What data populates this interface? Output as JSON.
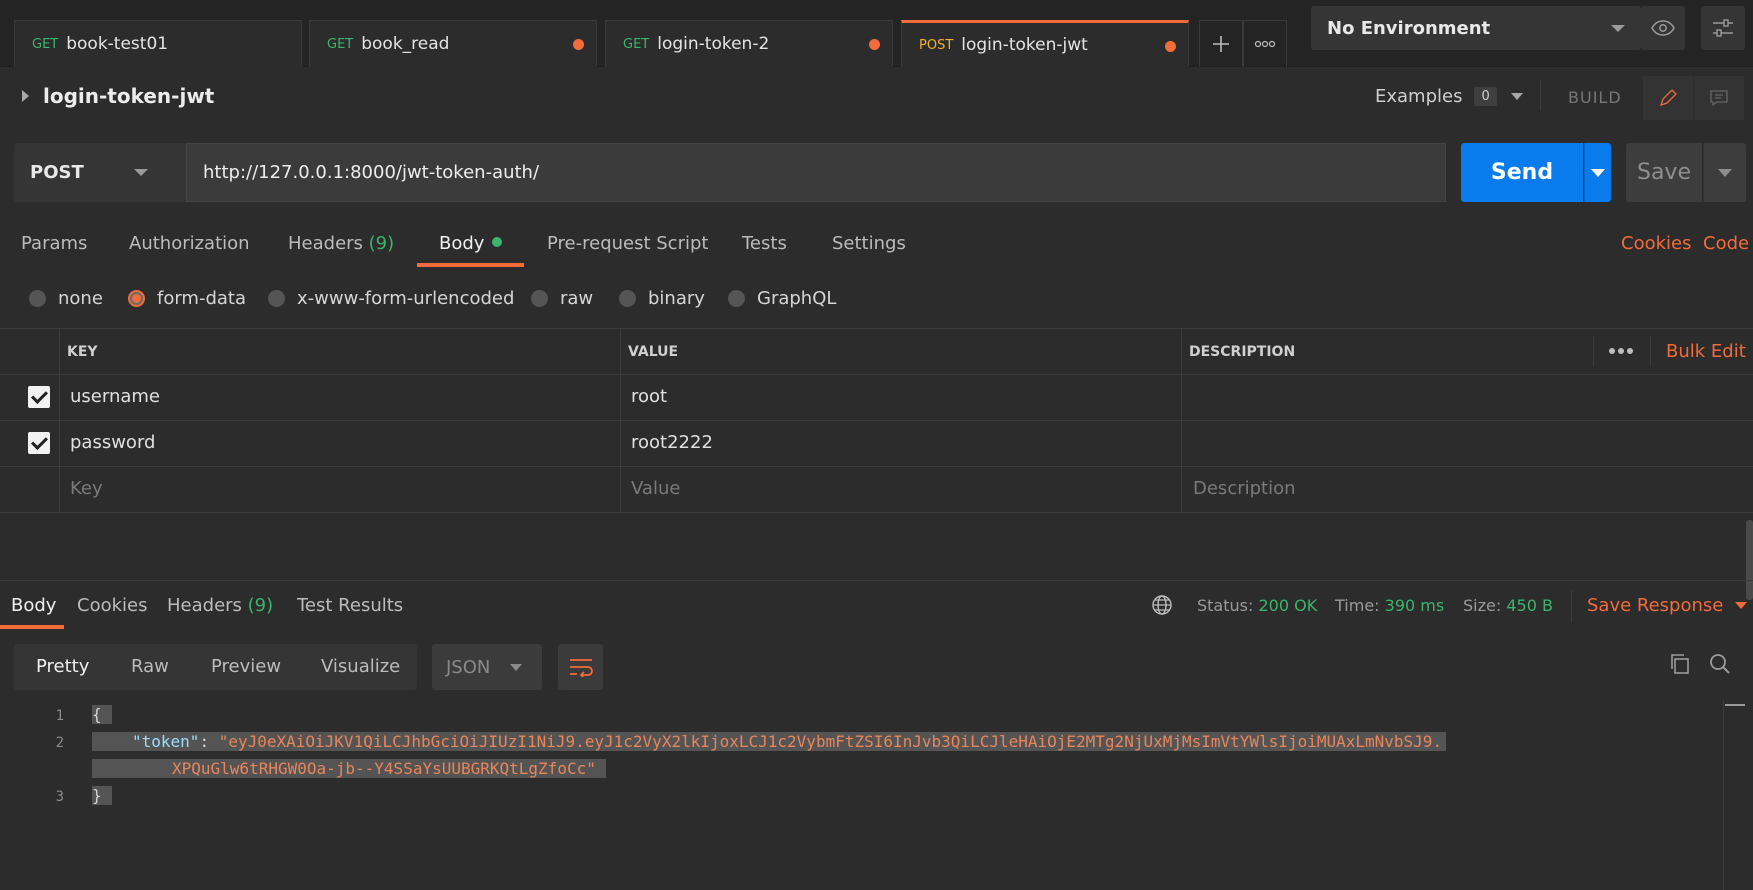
{
  "tabs": [
    {
      "method": "GET",
      "name": "book-test01",
      "unsaved": false
    },
    {
      "method": "GET",
      "name": "book_read",
      "unsaved": true
    },
    {
      "method": "GET",
      "name": "login-token-2",
      "unsaved": true
    },
    {
      "method": "POST",
      "name": "login-token-jwt",
      "unsaved": true,
      "active": true
    }
  ],
  "environment": "No Environment",
  "request": {
    "name": "login-token-jwt",
    "examples_label": "Examples",
    "examples_count": "0",
    "build_label": "BUILD",
    "method": "POST",
    "url": "http://127.0.0.1:8000/jwt-token-auth/",
    "send_label": "Send",
    "save_label": "Save"
  },
  "request_tabs": {
    "params": "Params",
    "authorization": "Authorization",
    "headers": "Headers",
    "headers_count": "(9)",
    "body": "Body",
    "prerequest": "Pre-request Script",
    "tests": "Tests",
    "settings": "Settings",
    "cookies": "Cookies",
    "code": "Code"
  },
  "body_modes": {
    "none": "none",
    "form_data": "form-data",
    "urlencoded": "x-www-form-urlencoded",
    "raw": "raw",
    "binary": "binary",
    "graphql": "GraphQL",
    "selected": "form-data"
  },
  "params_table": {
    "headers": {
      "key": "KEY",
      "value": "VALUE",
      "description": "DESCRIPTION"
    },
    "bulk_edit": "Bulk Edit",
    "rows": [
      {
        "key": "username",
        "value": "root",
        "checked": true
      },
      {
        "key": "password",
        "value": "root2222",
        "checked": true
      }
    ],
    "placeholders": {
      "key": "Key",
      "value": "Value",
      "description": "Description"
    }
  },
  "response": {
    "tabs": {
      "body": "Body",
      "cookies": "Cookies",
      "headers": "Headers",
      "headers_count": "(9)",
      "test_results": "Test Results"
    },
    "status_label": "Status:",
    "status_value": "200 OK",
    "time_label": "Time:",
    "time_value": "390 ms",
    "size_label": "Size:",
    "size_value": "450 B",
    "save_response": "Save Response",
    "views": {
      "pretty": "Pretty",
      "raw": "Raw",
      "preview": "Preview",
      "visualize": "Visualize"
    },
    "format": "JSON",
    "code": {
      "line_numbers": [
        "1",
        "2",
        "3"
      ],
      "open_brace": "{",
      "key": "\"token\"",
      "colon": ": ",
      "value_part1": "\"eyJ0eXAiOiJKV1QiLCJhbGciOiJIUzI1NiJ9.eyJ1c2VyX2lkIjoxLCJ1c2VybmFtZSI6InJvb3QiLCJleHAiOjE2MTg2NjUxMjMsImVtYWlsIjoiMUAxLmNvbSJ9.",
      "value_part2": "XPQuGlw6tRHGW0Oa-jb--Y4SSaYsUUBGRKQtLgZfoCc\"",
      "close_brace": "}"
    }
  },
  "colors": {
    "accent": "#f26b3a",
    "send": "#097bed",
    "success": "#3bb56b",
    "get": "#3bb56b",
    "post": "#f5b02b"
  }
}
